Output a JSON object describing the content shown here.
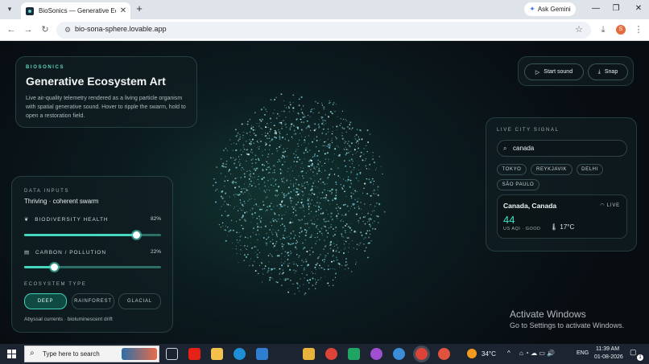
{
  "browser": {
    "tab_title": "BioSonics — Generative Ecosystem Art",
    "tab_close": "✕",
    "new_tab": "+",
    "ask_gemini": "Ask Gemini",
    "url": "bio-sona-sphere.lovable.app",
    "profile_initial": "S",
    "controls": {
      "minimize": "—",
      "restore": "❐",
      "close": "✕"
    }
  },
  "hero": {
    "eyebrow": "BIOSONICS",
    "title": "Generative Ecosystem Art",
    "description": "Live air-quality telemetry rendered as a living particle organism with spatial generative sound. Hover to ripple the swarm, hold to open a restoration field."
  },
  "actions": {
    "start_sound": "Start sound",
    "snap": "Snap"
  },
  "data_inputs": {
    "eyebrow": "DATA INPUTS",
    "state": "Thriving · coherent swarm",
    "biodiversity": {
      "label": "BIODIVERSITY HEALTH",
      "value_text": "82%",
      "value": 0.82
    },
    "carbon": {
      "label": "CARBON / POLLUTION",
      "value_text": "22%",
      "value": 0.22
    },
    "ecosystem_label": "ECOSYSTEM TYPE",
    "ecosystem_options": [
      "DEEP",
      "RAINFOREST",
      "GLACIAL"
    ],
    "ecosystem_selected": "DEEP",
    "ecosystem_caption": "Abyssal currents · bioluminescent drift"
  },
  "city_signal": {
    "eyebrow": "LIVE CITY SIGNAL",
    "search_value": "canada",
    "cities": [
      "TOKYO",
      "REYKJAVIK",
      "DELHI",
      "SÃO PAULO"
    ],
    "result": {
      "name": "Canada, Canada",
      "live_label": "LIVE",
      "aqi_value": "44",
      "aqi_label": "US AQI · GOOD",
      "temperature": "17°C"
    }
  },
  "windows": {
    "activate_title": "Activate Windows",
    "activate_sub": "Go to Settings to activate Windows.",
    "search_placeholder": "Type here to search",
    "weather_temp": "34°C",
    "language": "ENG",
    "time": "11:39 AM",
    "date": "01-08-2026",
    "notification_count": "1"
  },
  "colors": {
    "accent": "#46d8bf",
    "page_bg": "#080d12",
    "aqi_good": "#3fe0c0"
  }
}
